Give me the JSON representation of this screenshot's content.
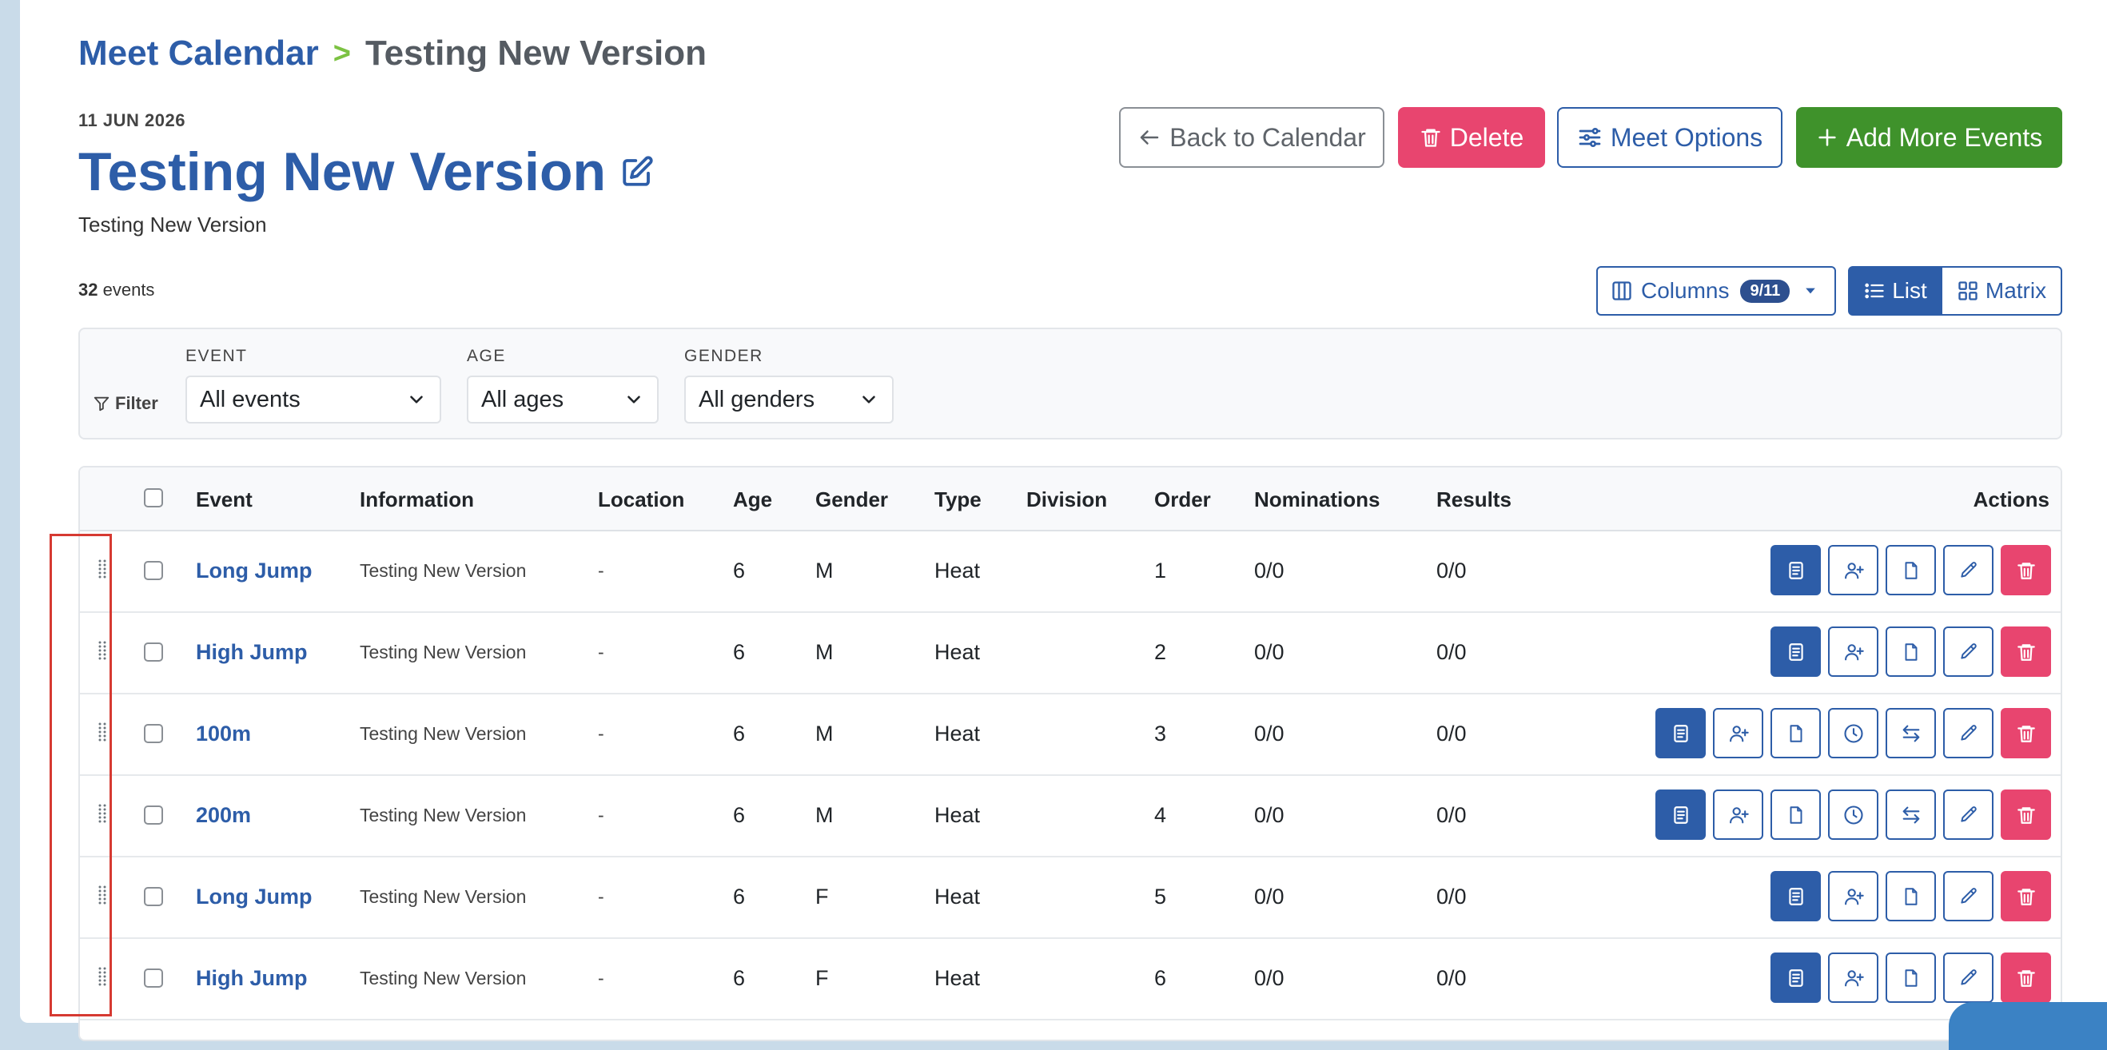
{
  "breadcrumb": {
    "parent": "Meet Calendar",
    "separator": ">",
    "current": "Testing New Version"
  },
  "meet": {
    "date": "11 JUN 2026",
    "title": "Testing New Version",
    "subtitle": "Testing New Version"
  },
  "buttons": {
    "back": "Back to Calendar",
    "delete": "Delete",
    "options": "Meet Options",
    "add": "Add More Events"
  },
  "summary": {
    "count": "32",
    "count_label": "events"
  },
  "columns_toggle": {
    "label": "Columns",
    "badge": "9/11"
  },
  "view": {
    "list": "List",
    "matrix": "Matrix",
    "active": "list"
  },
  "filters": {
    "label": "Filter",
    "event": {
      "caption": "EVENT",
      "value": "All events"
    },
    "age": {
      "caption": "AGE",
      "value": "All ages"
    },
    "gender": {
      "caption": "GENDER",
      "value": "All genders"
    }
  },
  "table": {
    "headers": [
      "Event",
      "Information",
      "Location",
      "Age",
      "Gender",
      "Type",
      "Division",
      "Order",
      "Nominations",
      "Results",
      "Actions"
    ],
    "rows": [
      {
        "event": "Long Jump",
        "info": "Testing New Version",
        "location": "-",
        "age": "6",
        "gender": "M",
        "type": "Heat",
        "division": "",
        "order": "1",
        "nominations": "0/0",
        "results": "0/0",
        "actions": [
          "details-icon",
          "add-athlete-icon",
          "file-icon",
          "edit-icon",
          "trash-icon"
        ]
      },
      {
        "event": "High Jump",
        "info": "Testing New Version",
        "location": "-",
        "age": "6",
        "gender": "M",
        "type": "Heat",
        "division": "",
        "order": "2",
        "nominations": "0/0",
        "results": "0/0",
        "actions": [
          "details-icon",
          "add-athlete-icon",
          "file-icon",
          "edit-icon",
          "trash-icon"
        ]
      },
      {
        "event": "100m",
        "info": "Testing New Version",
        "location": "-",
        "age": "6",
        "gender": "M",
        "type": "Heat",
        "division": "",
        "order": "3",
        "nominations": "0/0",
        "results": "0/0",
        "actions": [
          "details-icon",
          "add-athlete-icon",
          "file-icon",
          "clock-icon",
          "swap-icon",
          "edit-icon",
          "trash-icon"
        ]
      },
      {
        "event": "200m",
        "info": "Testing New Version",
        "location": "-",
        "age": "6",
        "gender": "M",
        "type": "Heat",
        "division": "",
        "order": "4",
        "nominations": "0/0",
        "results": "0/0",
        "actions": [
          "details-icon",
          "add-athlete-icon",
          "file-icon",
          "clock-icon",
          "swap-icon",
          "edit-icon",
          "trash-icon"
        ]
      },
      {
        "event": "Long Jump",
        "info": "Testing New Version",
        "location": "-",
        "age": "6",
        "gender": "F",
        "type": "Heat",
        "division": "",
        "order": "5",
        "nominations": "0/0",
        "results": "0/0",
        "actions": [
          "details-icon",
          "add-athlete-icon",
          "file-icon",
          "edit-icon",
          "trash-icon"
        ]
      },
      {
        "event": "High Jump",
        "info": "Testing New Version",
        "location": "-",
        "age": "6",
        "gender": "F",
        "type": "Heat",
        "division": "",
        "order": "6",
        "nominations": "0/0",
        "results": "0/0",
        "actions": [
          "details-icon",
          "add-athlete-icon",
          "file-icon",
          "edit-icon",
          "trash-icon"
        ]
      }
    ]
  },
  "colors": {
    "primary": "#2d5da8",
    "danger": "#e8456f",
    "success": "#3f922b",
    "highlight": "#d63a32",
    "page_bg": "#c9dbe9"
  }
}
